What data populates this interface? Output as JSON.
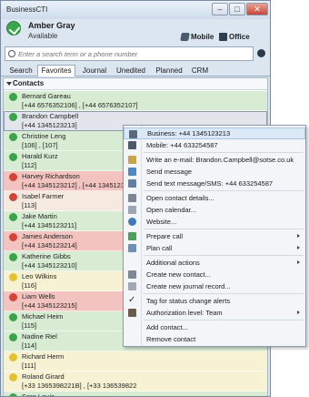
{
  "app": {
    "title": "BusinessCTI"
  },
  "window_buttons": {
    "minimize": "–",
    "maximize": "□",
    "close": "✕"
  },
  "user": {
    "name": "Amber Gray",
    "status": "Available"
  },
  "devices": [
    {
      "label": "Mobile",
      "icon": "mobile-phone-icon"
    },
    {
      "label": "Office",
      "icon": "desk-phone-icon"
    }
  ],
  "search": {
    "placeholder": "Enter a search term or a phone number"
  },
  "tabs": [
    {
      "label": "Search",
      "active": false
    },
    {
      "label": "Favorites",
      "active": true
    },
    {
      "label": "Journal",
      "active": false
    },
    {
      "label": "Unedited",
      "active": false
    },
    {
      "label": "Planned",
      "active": false
    },
    {
      "label": "CRM",
      "active": false
    }
  ],
  "contacts_header": "Contacts",
  "contacts": [
    {
      "name": "Bernard Gareau",
      "number": "[+44 6576352106] , [+44 6576352107]",
      "bg": "#d7ecd2",
      "dot": "#3ba34a"
    },
    {
      "name": "Brandon Campbell",
      "number": "[+44 1345123213]",
      "bg": "#e2e6ec",
      "dot": "#3ba34a",
      "selected": true
    },
    {
      "name": "Christine Leng",
      "number": "[106] , [107]",
      "bg": "#d7ecd2",
      "dot": "#3ba34a"
    },
    {
      "name": "Harald Kurz",
      "number": "[112]",
      "bg": "#d7ecd2",
      "dot": "#3ba34a"
    },
    {
      "name": "Harvey Richardson",
      "number": "[+44 1345123212] , [+44 1345123",
      "bg": "#f3c4bf",
      "dot": "#d2453b"
    },
    {
      "name": "Isabel Farmer",
      "number": "[113]",
      "bg": "#f5e9e0",
      "dot": "#d2453b"
    },
    {
      "name": "Jake Martin",
      "number": "[+44 1345123211]",
      "bg": "#d7ecd2",
      "dot": "#3ba34a"
    },
    {
      "name": "James Anderson",
      "number": "[+44 1345123214]",
      "bg": "#f3c4bf",
      "dot": "#d2453b"
    },
    {
      "name": "Katherine Gibbs",
      "number": "[+44 1345123210]",
      "bg": "#d7ecd2",
      "dot": "#3ba34a"
    },
    {
      "name": "Leo Wilkins",
      "number": "[116]",
      "bg": "#f7f2d3",
      "dot": "#e3c230"
    },
    {
      "name": "Liam Wells",
      "number": "[+44 1345123215]",
      "bg": "#f3c4bf",
      "dot": "#d2453b"
    },
    {
      "name": "Michael Heim",
      "number": "[115]",
      "bg": "#d7ecd2",
      "dot": "#3ba34a"
    },
    {
      "name": "Nadine Riel",
      "number": "[114]",
      "bg": "#d7ecd2",
      "dot": "#3ba34a"
    },
    {
      "name": "Richard Herm",
      "number": "[111]",
      "bg": "#f7f2d3",
      "dot": "#e3c230"
    },
    {
      "name": "Roland Girard",
      "number": "[+33 1365398221B] , [+33 136539822",
      "bg": "#f7f2d3",
      "dot": "#e3c230"
    },
    {
      "name": "Sara Louis",
      "number": "",
      "bg": "#d7ecd2",
      "dot": "#3ba34a"
    }
  ],
  "context_menu": {
    "items": [
      {
        "label": "Business: +44 1345123213",
        "icon": "business-phone-icon",
        "highlighted": true
      },
      {
        "label": "Mobile: +44 633254587",
        "icon": "mobile-phone-icon"
      },
      {
        "sep": true
      },
      {
        "label": "Write an e-mail: Brandon.Campbell@sotse.co.uk",
        "icon": "email-icon"
      },
      {
        "label": "Send message",
        "icon": "chat-message-icon"
      },
      {
        "label": "Send text message/SMS: +44 633254587",
        "icon": "sms-icon"
      },
      {
        "sep": true
      },
      {
        "label": "Open contact details...",
        "icon": "contact-card-icon"
      },
      {
        "label": "Open calendar...",
        "icon": "calendar-icon"
      },
      {
        "label": "Website...",
        "icon": "globe-icon"
      },
      {
        "sep": true
      },
      {
        "label": "Prepare call",
        "icon": "prepare-call-icon",
        "submenu": true
      },
      {
        "label": "Plan call",
        "icon": "plan-call-icon",
        "submenu": true
      },
      {
        "sep": true
      },
      {
        "label": "Additional actions",
        "icon": "",
        "submenu": true
      },
      {
        "label": "Create new contact...",
        "icon": "new-contact-icon"
      },
      {
        "label": "Create new journal record...",
        "icon": "new-journal-icon"
      },
      {
        "sep": true
      },
      {
        "label": "Tag for status change alerts",
        "icon": "checkmark-icon",
        "checked": true
      },
      {
        "label": "Authorization level: Team",
        "icon": "team-icon",
        "submenu": true
      },
      {
        "sep": true
      },
      {
        "label": "Add contact...",
        "icon": ""
      },
      {
        "label": "Remove contact",
        "icon": ""
      }
    ]
  }
}
